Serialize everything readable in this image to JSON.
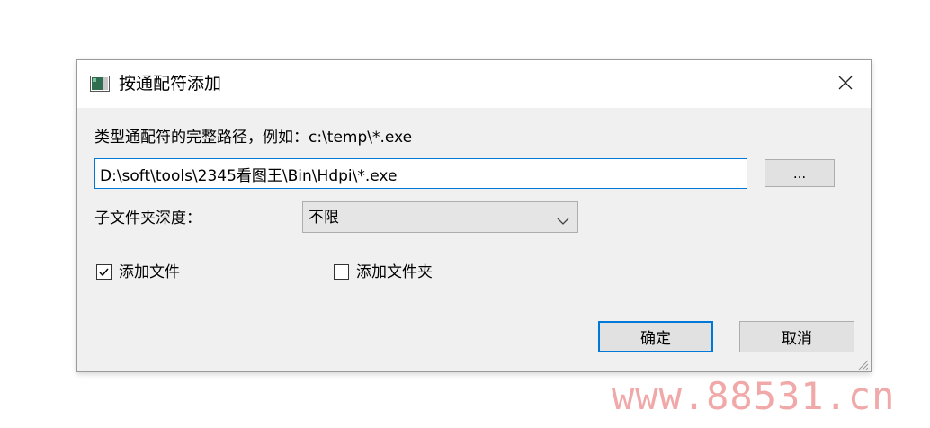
{
  "window": {
    "title": "按通配符添加",
    "icon": "app-window-icon",
    "close_icon": "close-icon"
  },
  "form": {
    "path_label": "类型通配符的完整路径，例如：c:\\temp\\*.exe",
    "path_value": "D:\\soft\\tools\\2345看图王\\Bin\\Hdpi\\*.exe",
    "browse_label": "...",
    "depth_label": "子文件夹深度：",
    "depth_value": "不限",
    "add_files_label": "添加文件",
    "add_files_checked": true,
    "add_folders_label": "添加文件夹",
    "add_folders_checked": false
  },
  "buttons": {
    "ok_label": "确定",
    "cancel_label": "取消"
  },
  "watermark": "www.88531.cn",
  "colors": {
    "accent": "#0078d7",
    "dialog_bg": "#f0f0f0",
    "button_bg": "#e1e1e1",
    "watermark": "#f0a8a8"
  }
}
